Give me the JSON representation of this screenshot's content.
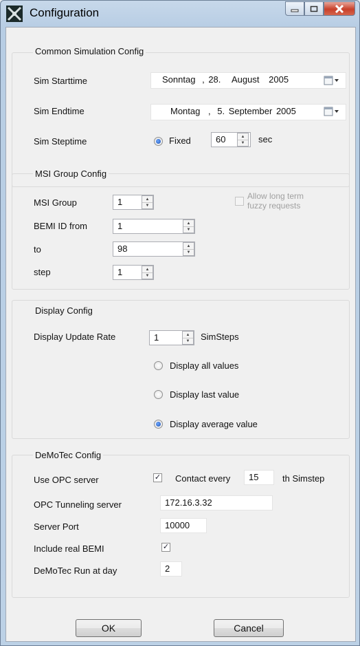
{
  "window": {
    "title": "Configuration",
    "icon": "app-icon"
  },
  "common": {
    "title": "Common Simulation Config",
    "start_label": "Sim Starttime",
    "start": {
      "day": "Sonntag",
      "sep": ",",
      "date": "28.",
      "month": "August",
      "year": "2005"
    },
    "end_label": "Sim Endtime",
    "end": {
      "day": "Montag",
      "sep": ",",
      "date": "5.",
      "month": "September",
      "year": "2005"
    },
    "step_label": "Sim Steptime",
    "fixed_label": "Fixed",
    "step_value": "60",
    "step_unit": "sec"
  },
  "msi": {
    "title": "MSI Group Config",
    "group_label": "MSI Group",
    "group_value": "1",
    "long_term_line1": "Allow long term",
    "long_term_line2": "fuzzy requests",
    "from_label": "BEMI ID from",
    "from_value": "1",
    "to_label": "to",
    "to_value": "98",
    "step_label": "step",
    "step_value": "1"
  },
  "display": {
    "title": "Display Config",
    "rate_label": "Display Update Rate",
    "rate_value": "1",
    "rate_unit": "SimSteps",
    "opt_all": "Display all values",
    "opt_last": "Display last value",
    "opt_avg": "Display average value",
    "selected": "opt_avg"
  },
  "demotec": {
    "title": "DeMoTec Config",
    "use_opc_label": "Use OPC server",
    "use_opc_checked": true,
    "contact_label": "Contact every",
    "contact_value": "15",
    "contact_suffix": "th Simstep",
    "tunnel_label": "OPC Tunneling server",
    "tunnel_value": "172.16.3.32",
    "port_label": "Server Port",
    "port_value": "10000",
    "real_bemi_label": "Include real BEMI",
    "real_bemi_checked": true,
    "runday_label": "DeMoTec Run at day",
    "runday_value": "2"
  },
  "buttons": {
    "ok": "OK",
    "cancel": "Cancel"
  }
}
